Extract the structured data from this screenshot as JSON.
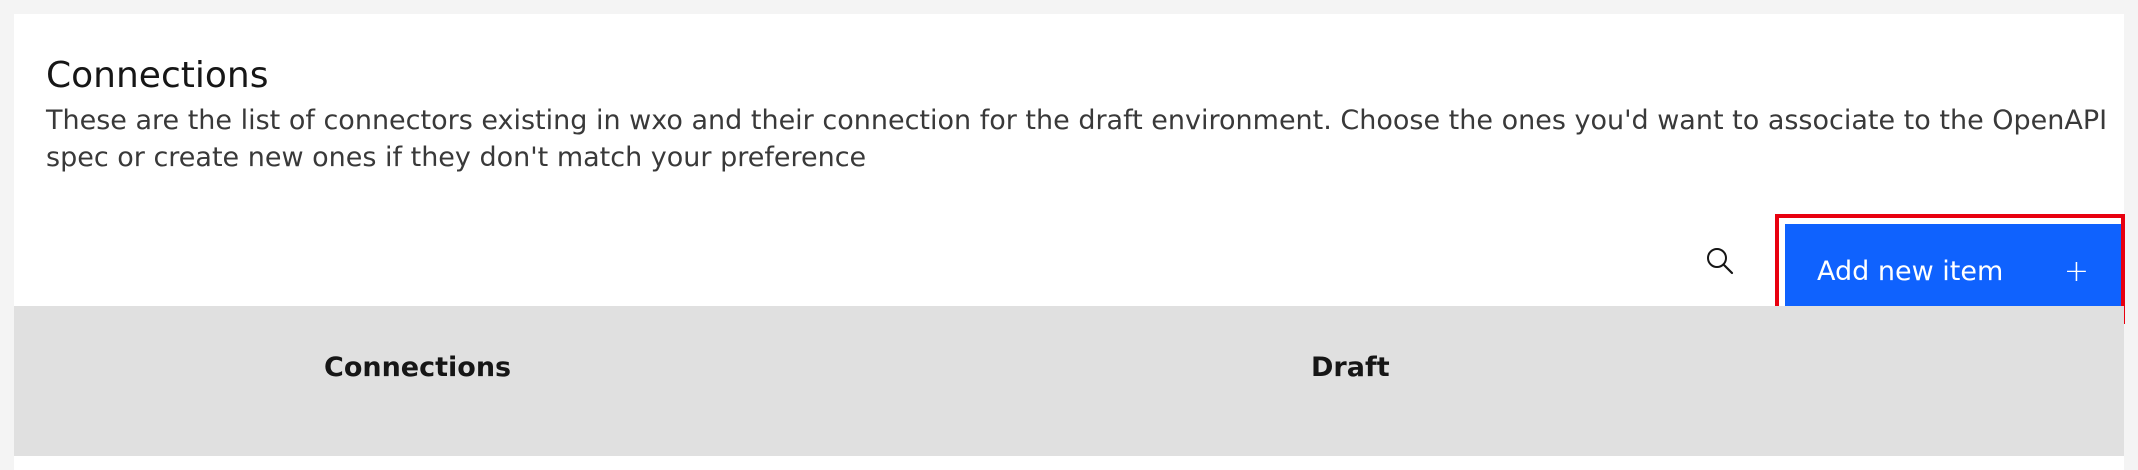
{
  "section": {
    "title": "Connections",
    "description": "These are the list of connectors existing in wxo and their connection for the draft environment. Choose the ones you'd want to associate to the OpenAPI spec or create new ones if they don't match your preference"
  },
  "toolbar": {
    "search_icon": "search-icon",
    "add_button_label": "Add new item",
    "add_button_icon": "+"
  },
  "table": {
    "columns": [
      "Connections",
      "Draft"
    ]
  },
  "colors": {
    "primary": "#0f62fe",
    "highlight": "#e8000f",
    "header_bg": "#e0e0e0"
  }
}
